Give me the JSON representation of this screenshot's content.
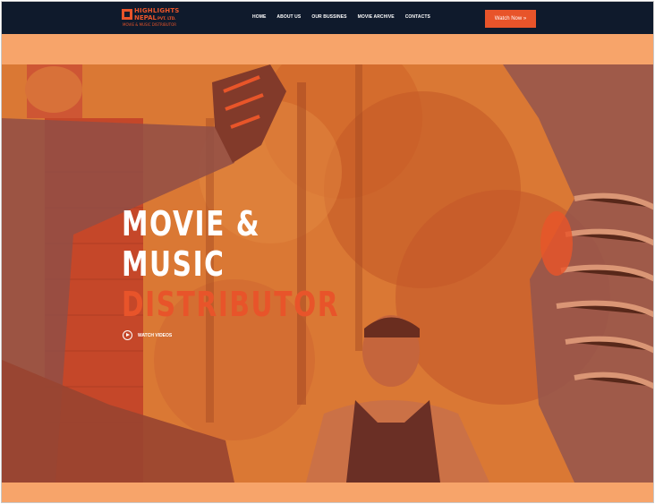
{
  "brand": {
    "name_line1": "HIGHLIGHTS",
    "name_line2": "NEPAL",
    "name_suffix": "PVT. LTD.",
    "tagline": "MOVIE & MUSIC DISTRIBUTOR"
  },
  "nav": {
    "items": [
      {
        "label": "HOME"
      },
      {
        "label": "ABOUT US"
      },
      {
        "label": "OUR BUSSINES"
      },
      {
        "label": "MOVIE ARCHIVE"
      },
      {
        "label": "CONTACTS"
      }
    ]
  },
  "header": {
    "cta_label": "Watch Now »"
  },
  "hero": {
    "line1": "MOVIE &",
    "line2": "MUSIC",
    "line3": "DISTRIBUTOR",
    "watch_label": "WATCH VIDEOS"
  },
  "colors": {
    "header_bg": "#0f1a2c",
    "accent": "#e8542a",
    "band": "#f7a46a"
  }
}
